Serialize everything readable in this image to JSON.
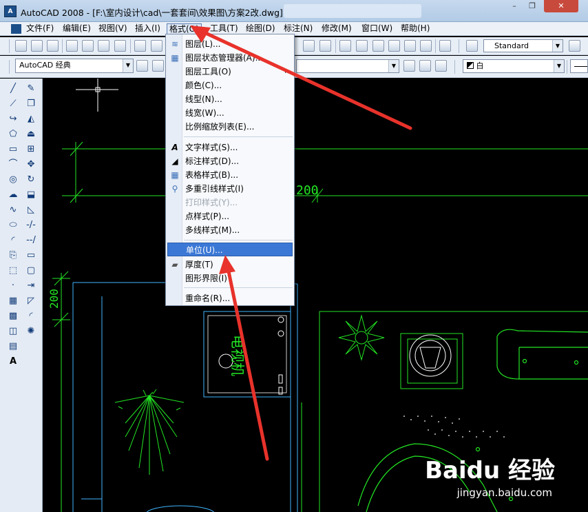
{
  "window": {
    "app_icon_text": "A",
    "title": "AutoCAD 2008 - [F:\\室内设计\\cad\\一套套间\\效果图\\方案2改.dwg]",
    "minimize": "–",
    "restore": "❐",
    "close": "✕"
  },
  "menubar": {
    "items": [
      "文件(F)",
      "编辑(E)",
      "视图(V)",
      "插入(I)",
      "格式(O)",
      "工具(T)",
      "绘图(D)",
      "标注(N)",
      "修改(M)",
      "窗口(W)",
      "帮助(H)"
    ]
  },
  "toolbar2": {
    "workspace": "AutoCAD 经典",
    "text_style": "Standard",
    "color": "白"
  },
  "format_menu": {
    "items": [
      {
        "label": "图层(L)...",
        "icon": "layers-icon"
      },
      {
        "label": "图层状态管理器(A)...",
        "icon": "layer-state-icon"
      },
      {
        "label": "图层工具(O)",
        "icon": "",
        "arrow": "▸"
      },
      {
        "label": "颜色(C)...",
        "icon": ""
      },
      {
        "label": "线型(N)...",
        "icon": ""
      },
      {
        "label": "线宽(W)...",
        "icon": ""
      },
      {
        "label": "比例缩放列表(E)...",
        "icon": ""
      },
      {
        "label": "文字样式(S)...",
        "icon": "text-style-icon"
      },
      {
        "label": "标注样式(D)...",
        "icon": "dim-style-icon"
      },
      {
        "label": "表格样式(B)...",
        "icon": "table-style-icon"
      },
      {
        "label": "多重引线样式(I)",
        "icon": "mleader-style-icon"
      },
      {
        "label": "打印样式(Y)...",
        "icon": "",
        "disabled": true
      },
      {
        "label": "点样式(P)...",
        "icon": ""
      },
      {
        "label": "多线样式(M)...",
        "icon": ""
      },
      {
        "label": "单位(U)...",
        "icon": "",
        "selected": true
      },
      {
        "label": "厚度(T)",
        "icon": "thickness-icon"
      },
      {
        "label": "图形界限(I)",
        "icon": ""
      },
      {
        "label": "重命名(R)...",
        "icon": ""
      }
    ]
  },
  "drawing": {
    "dim_text_1": "200",
    "dim_text_2": "200",
    "tv_label": "电视机"
  },
  "watermark": {
    "brand": "Baidu 经验",
    "url": "jingyan.baidu.com"
  },
  "colors": {
    "cad_green": "#23e623",
    "cad_cyan": "#3fb6ff",
    "annotation_red": "#e8322b",
    "menu_highlight": "#3b78d6"
  }
}
